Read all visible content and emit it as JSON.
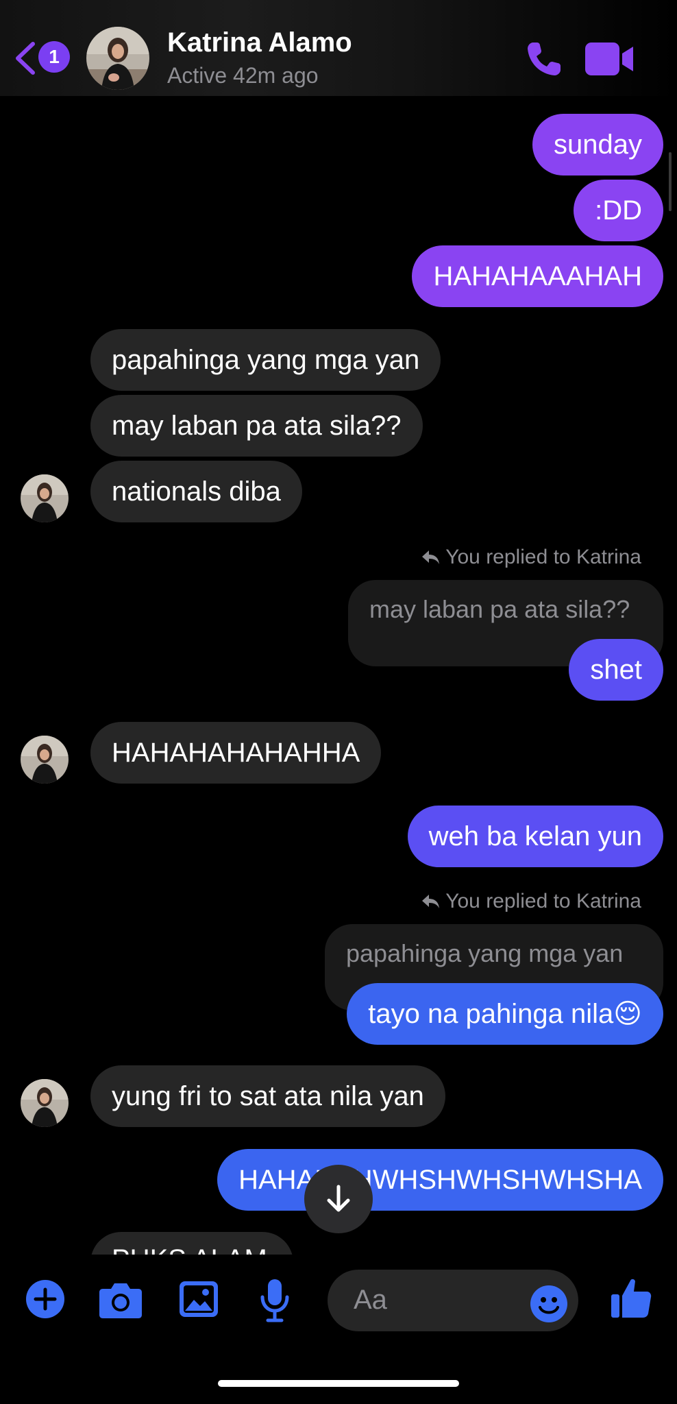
{
  "header": {
    "back_badge_count": "1",
    "contact_name": "Katrina Alamo",
    "status": "Active 42m ago",
    "accent_color": "#7b3ff2"
  },
  "messages": [
    {
      "sender": "me",
      "text": "sunday"
    },
    {
      "sender": "me",
      "text": ":DD"
    },
    {
      "sender": "me",
      "text": "HAHAHAAAHAH"
    },
    {
      "sender": "them",
      "text": "papahinga yang mga yan"
    },
    {
      "sender": "them",
      "text": "may laban pa ata sila??"
    },
    {
      "sender": "them",
      "text": "nationals diba"
    },
    {
      "sender": "me",
      "reply_label": "You replied to Katrina",
      "quoted": "may laban pa ata sila??",
      "text": "shet"
    },
    {
      "sender": "them",
      "text": "HAHAHAHAHAHHA"
    },
    {
      "sender": "me",
      "text": "weh ba kelan yun"
    },
    {
      "sender": "me",
      "reply_label": "You replied to Katrina",
      "quoted": "papahinga yang mga yan",
      "text": "tayo na pahinga nila😌"
    },
    {
      "sender": "them",
      "text": "yung fri to sat ata nila yan"
    },
    {
      "sender": "me",
      "text": "HAHAHAHWHSHWHSHWHSHA"
    },
    {
      "sender": "them",
      "text": "PUKS ALAM",
      "partially_visible": true
    }
  ],
  "composer": {
    "placeholder": "Aa"
  },
  "icons": {
    "back": "chevron-left-icon",
    "call": "phone-icon",
    "video": "video-camera-icon",
    "scroll": "arrow-down-icon",
    "plus": "plus-icon",
    "camera": "camera-icon",
    "gallery": "image-icon",
    "mic": "microphone-icon",
    "emoji": "smiley-icon",
    "like": "thumbs-up-icon"
  },
  "colors": {
    "outgoing_top": "#8a44f2",
    "outgoing_mid": "#5b4ff3",
    "outgoing_bottom": "#3b65f0",
    "incoming": "#262626",
    "composer_icons": "#3b6df6"
  }
}
